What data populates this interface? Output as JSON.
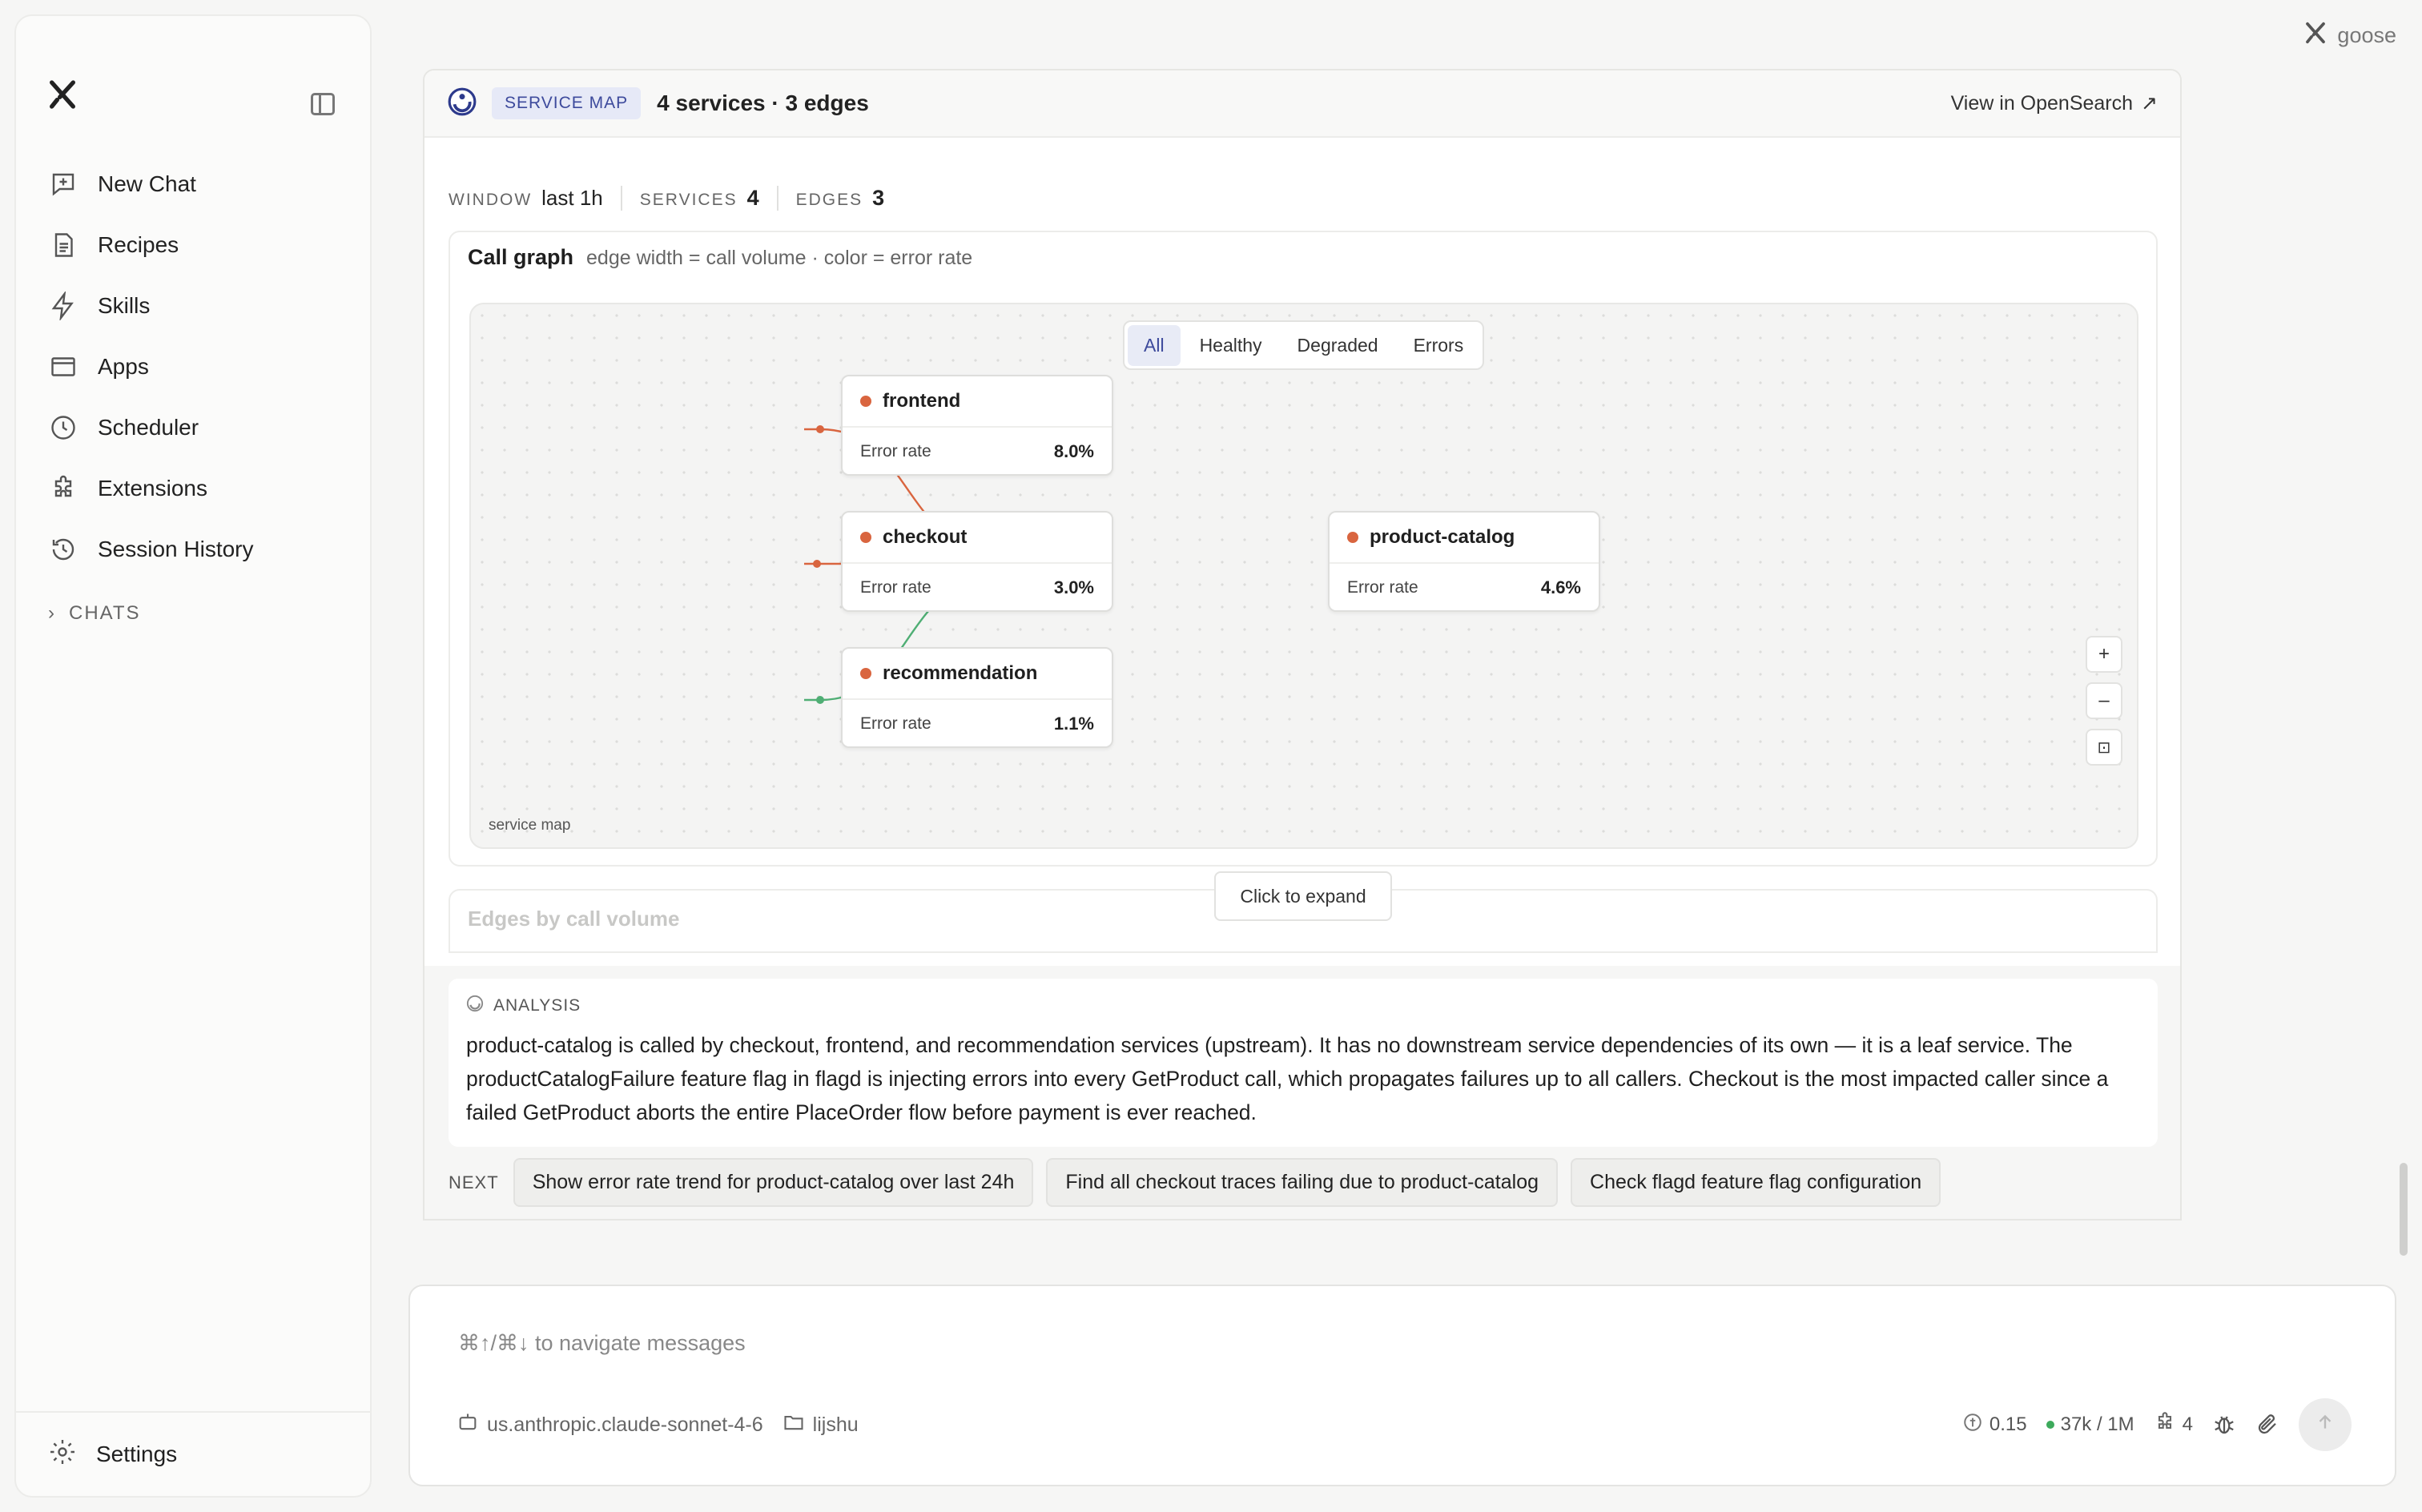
{
  "window": {
    "brand": "goose"
  },
  "sidebar": {
    "items": [
      {
        "label": "New Chat",
        "icon": "new-chat-icon"
      },
      {
        "label": "Recipes",
        "icon": "document-icon"
      },
      {
        "label": "Skills",
        "icon": "lightning-icon"
      },
      {
        "label": "Apps",
        "icon": "window-icon"
      },
      {
        "label": "Scheduler",
        "icon": "clock-icon"
      },
      {
        "label": "Extensions",
        "icon": "puzzle-icon"
      },
      {
        "label": "Session History",
        "icon": "history-icon"
      }
    ],
    "chats_label": "CHATS",
    "settings_label": "Settings"
  },
  "card": {
    "badge": "SERVICE MAP",
    "title": "4 services · 3 edges",
    "view_link": "View in OpenSearch",
    "stats": {
      "window_key": "WINDOW",
      "window_val": "last 1h",
      "services_key": "SERVICES",
      "services_val": "4",
      "edges_key": "EDGES",
      "edges_val": "3"
    },
    "graph": {
      "title": "Call graph",
      "subtitle": "edge width = call volume · color = error rate",
      "filters": [
        "All",
        "Healthy",
        "Degraded",
        "Errors"
      ],
      "active_filter": "All",
      "canvas_label": "service map",
      "nodes": [
        {
          "name": "frontend",
          "metric_label": "Error rate",
          "metric_value": "8.0%"
        },
        {
          "name": "checkout",
          "metric_label": "Error rate",
          "metric_value": "3.0%"
        },
        {
          "name": "recommendation",
          "metric_label": "Error rate",
          "metric_value": "1.1%"
        },
        {
          "name": "product-catalog",
          "metric_label": "Error rate",
          "metric_value": "4.6%"
        }
      ],
      "edges": [
        {
          "from": "frontend",
          "to": "product-catalog",
          "color": "#d9653f"
        },
        {
          "from": "checkout",
          "to": "product-catalog",
          "color": "#d9653f"
        },
        {
          "from": "recommendation",
          "to": "product-catalog",
          "color": "#4fae74"
        }
      ],
      "zoom": {
        "in": "+",
        "out": "–",
        "fit": "⊡"
      }
    },
    "edges_table_title": "Edges by call volume",
    "expand_label": "Click to expand",
    "analysis": {
      "heading": "ANALYSIS",
      "text": "product-catalog is called by checkout, frontend, and recommendation services (upstream). It has no downstream service dependencies of its own — it is a leaf service. The productCatalogFailure feature flag in flagd is injecting errors into every GetProduct call, which propagates failures up to all callers. Checkout is the most impacted caller since a failed GetProduct aborts the entire PlaceOrder flow before payment is ever reached."
    },
    "next": {
      "label": "NEXT",
      "suggestions": [
        "Show error rate trend for product-catalog over last 24h",
        "Find all checkout traces failing due to product-catalog",
        "Check flagd feature flag configuration"
      ]
    }
  },
  "composer": {
    "placeholder": "⌘↑/⌘↓ to navigate messages",
    "model": "us.anthropic.claude-sonnet-4-6",
    "folder": "lijshu",
    "cost": "0.15",
    "tokens": "37k / 1M",
    "extensions_count": "4"
  }
}
